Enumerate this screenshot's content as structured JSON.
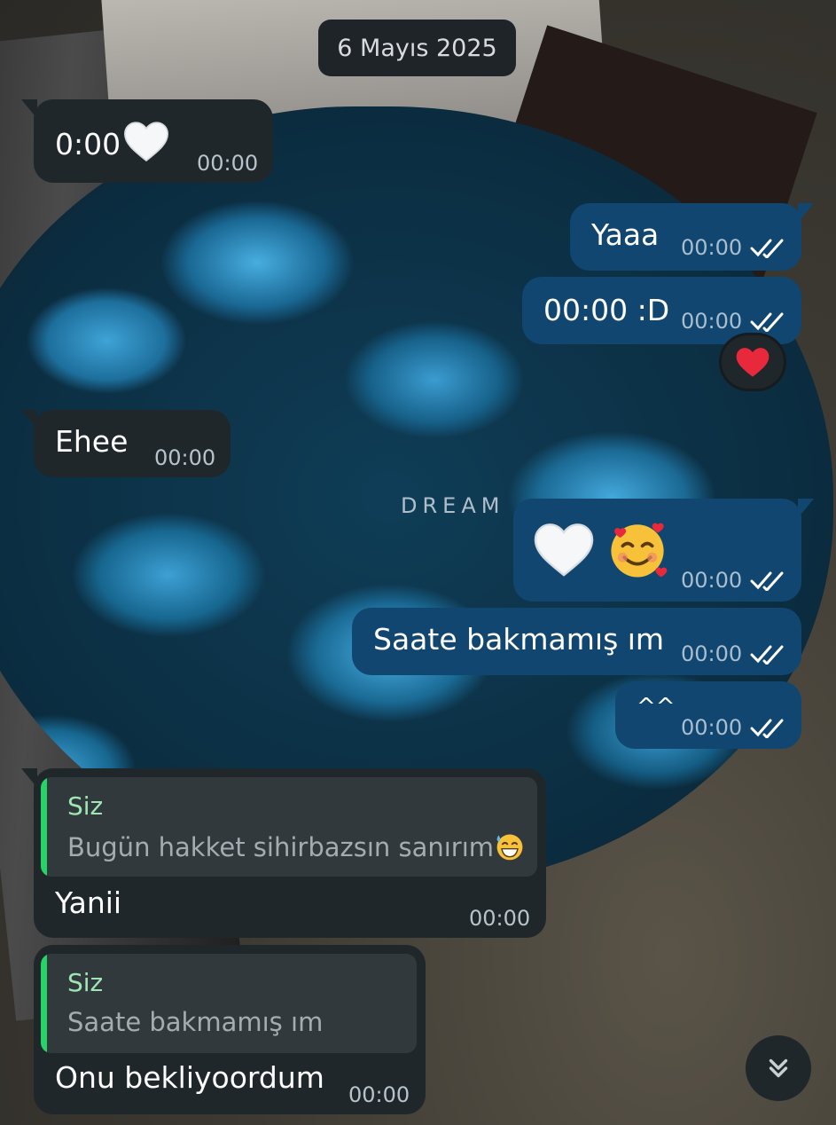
{
  "date_chip": "6 Mayıs 2025",
  "messages": [
    {
      "id": "m1",
      "direction": "incoming",
      "text": "0:00",
      "emoji": "white-heart",
      "time": "00:00"
    },
    {
      "id": "m2",
      "direction": "outgoing",
      "text": "Yaaa",
      "time": "00:00",
      "status": "read"
    },
    {
      "id": "m3",
      "direction": "outgoing",
      "text": "00:00 :D",
      "time": "00:00",
      "status": "read",
      "reaction": "red-heart"
    },
    {
      "id": "m4",
      "direction": "incoming",
      "text": "Ehee",
      "time": "00:00"
    },
    {
      "id": "m5",
      "direction": "outgoing",
      "text": "",
      "emoji": [
        "white-heart",
        "smiling-face-with-hearts"
      ],
      "time": "00:00",
      "status": "read"
    },
    {
      "id": "m6",
      "direction": "outgoing",
      "text": "Saate bakmamış ım",
      "time": "00:00",
      "status": "read"
    },
    {
      "id": "m7",
      "direction": "outgoing",
      "text": "^^",
      "time": "00:00",
      "status": "read"
    },
    {
      "id": "m8",
      "direction": "incoming",
      "text": "Yanii",
      "time": "00:00",
      "reply": {
        "author": "Siz",
        "text": "Bugün hakket sihirbazsın sanırım",
        "emoji": "grinning-face-with-sweat"
      }
    },
    {
      "id": "m9",
      "direction": "incoming",
      "text": "Onu bekliyoordum",
      "time": "00:00",
      "reply": {
        "author": "Siz",
        "text": "Saate bakmamış ım"
      }
    }
  ],
  "background": {
    "watermark": "DREAM"
  },
  "icons": {
    "read_ticks": "double-check-icon",
    "scroll": "double-chevron-down-icon"
  },
  "colors": {
    "incoming": "#1f272b",
    "outgoing": "#10466f",
    "reply_bar": "#25d366",
    "reply_author": "#9ee6b4",
    "ticks": "#ffffff"
  }
}
